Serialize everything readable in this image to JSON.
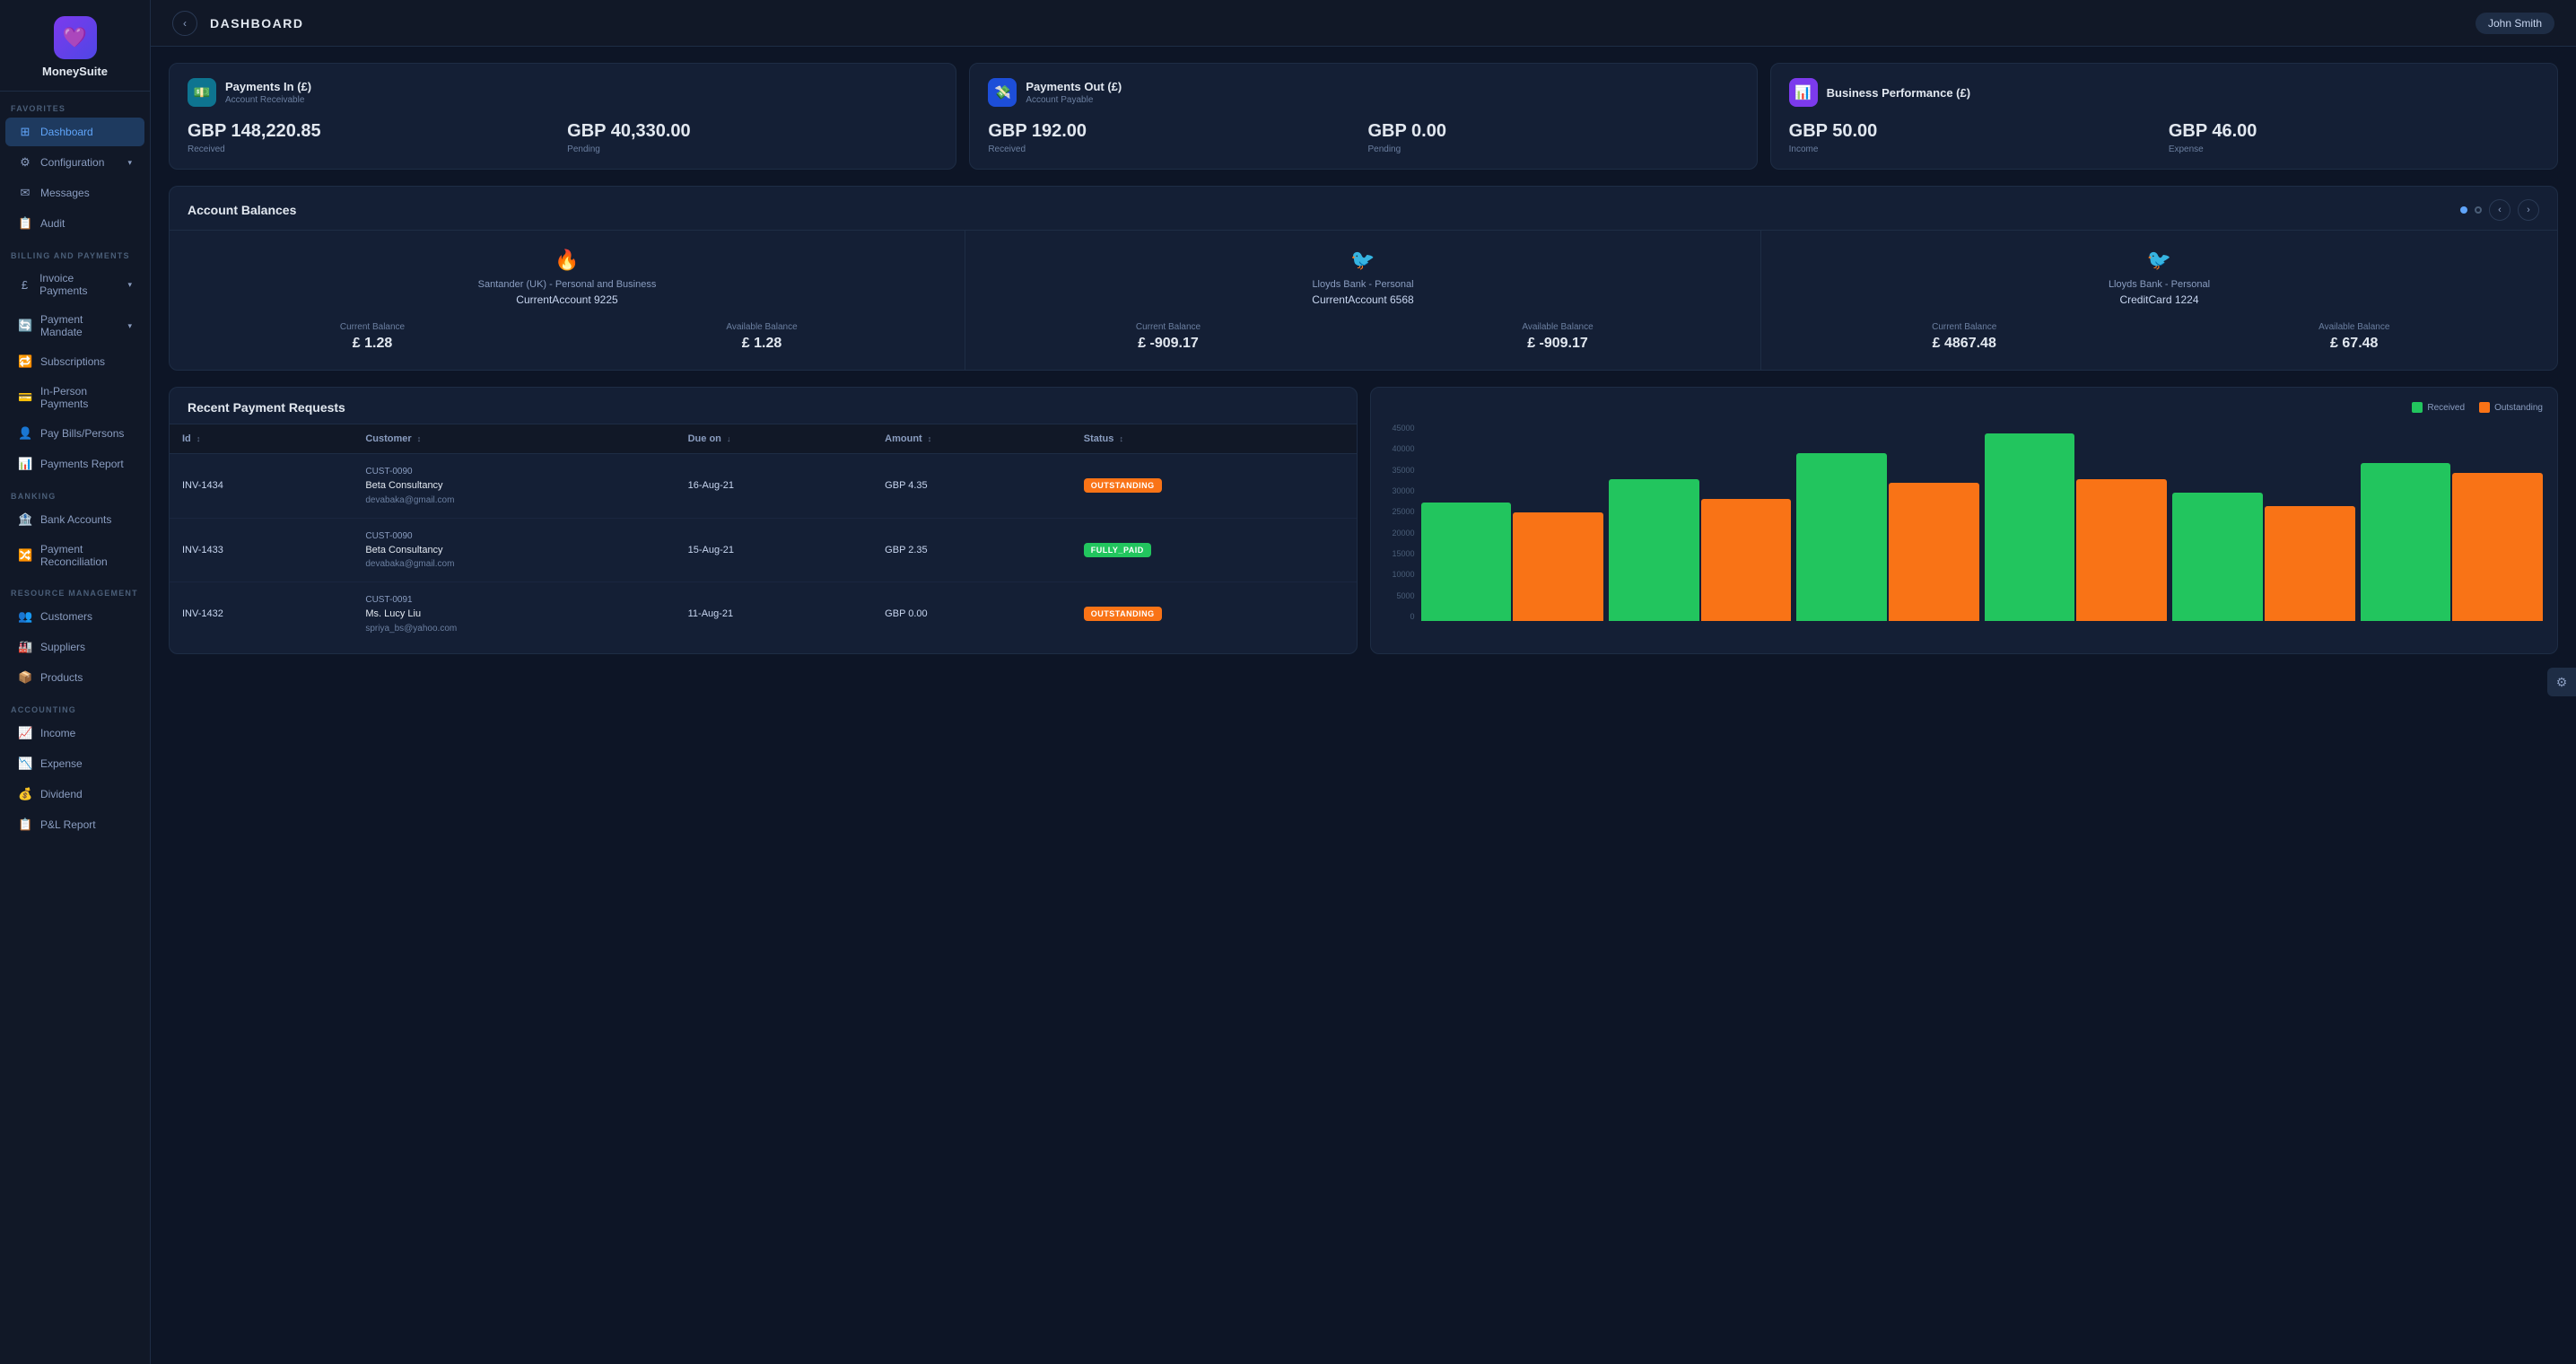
{
  "app": {
    "name": "MoneySuite",
    "logo_emoji": "💜"
  },
  "header": {
    "title": "DASHBOARD",
    "user": "John Smith",
    "back_label": "‹"
  },
  "sidebar": {
    "favorites_label": "FAVORITES",
    "favorites_items": [
      {
        "id": "dashboard",
        "label": "Dashboard",
        "icon": "⊞",
        "active": true
      },
      {
        "id": "configuration",
        "label": "Configuration",
        "icon": "⚙",
        "arrow": "▾"
      },
      {
        "id": "messages",
        "label": "Messages",
        "icon": "✉"
      },
      {
        "id": "audit",
        "label": "Audit",
        "icon": "📋"
      }
    ],
    "billing_label": "BILLING AND PAYMENTS",
    "billing_items": [
      {
        "id": "invoice-payments",
        "label": "Invoice Payments",
        "icon": "£",
        "arrow": "▾"
      },
      {
        "id": "payment-mandate",
        "label": "Payment Mandate",
        "icon": "🔄",
        "arrow": "▾"
      },
      {
        "id": "subscriptions",
        "label": "Subscriptions",
        "icon": "🔁"
      },
      {
        "id": "in-person",
        "label": "In-Person Payments",
        "icon": "💳"
      },
      {
        "id": "pay-bills",
        "label": "Pay Bills/Persons",
        "icon": "👤"
      },
      {
        "id": "payments-report",
        "label": "Payments Report",
        "icon": "📊"
      }
    ],
    "banking_label": "BANKING",
    "banking_items": [
      {
        "id": "bank-accounts",
        "label": "Bank Accounts",
        "icon": "🏦"
      },
      {
        "id": "payment-recon",
        "label": "Payment Reconciliation",
        "icon": "🔀"
      }
    ],
    "resource_label": "RESOURCE MANAGEMENT",
    "resource_items": [
      {
        "id": "customers",
        "label": "Customers",
        "icon": "👥"
      },
      {
        "id": "suppliers",
        "label": "Suppliers",
        "icon": "🏭"
      },
      {
        "id": "products",
        "label": "Products",
        "icon": "📦"
      }
    ],
    "accounting_label": "ACCOUNTING",
    "accounting_items": [
      {
        "id": "income",
        "label": "Income",
        "icon": "📈"
      },
      {
        "id": "expense",
        "label": "Expense",
        "icon": "📉"
      },
      {
        "id": "dividend",
        "label": "Dividend",
        "icon": "💰"
      },
      {
        "id": "pl-report",
        "label": "P&L Report",
        "icon": "📋"
      }
    ]
  },
  "metrics": {
    "payments_in": {
      "title": "Payments In (£)",
      "subtitle": "Account Receivable",
      "received_amount": "GBP 148,220.85",
      "received_label": "Received",
      "pending_amount": "GBP 40,330.00",
      "pending_label": "Pending"
    },
    "payments_out": {
      "title": "Payments Out (£)",
      "subtitle": "Account Payable",
      "received_amount": "GBP 192.00",
      "received_label": "Received",
      "pending_amount": "GBP 0.00",
      "pending_label": "Pending"
    },
    "business_performance": {
      "title": "Business Performance (£)",
      "income_amount": "GBP 50.00",
      "income_label": "Income",
      "expense_amount": "GBP 46.00",
      "expense_label": "Expense"
    }
  },
  "account_balances": {
    "section_title": "Account Balances",
    "cards": [
      {
        "bank": "Santander (UK) - Personal and Business",
        "account_label": "CurrentAccount 9225",
        "current_balance_label": "Current Balance",
        "current_balance": "£ 1.28",
        "available_balance_label": "Available Balance",
        "available_balance": "£ 1.28",
        "icon": "🔥"
      },
      {
        "bank": "Lloyds Bank - Personal",
        "account_label": "CurrentAccount 6568",
        "current_balance_label": "Current Balance",
        "current_balance": "£ -909.17",
        "available_balance_label": "Available Balance",
        "available_balance": "£ -909.17",
        "icon": "🦅"
      },
      {
        "bank": "Lloyds Bank - Personal",
        "account_label": "CreditCard 1224",
        "current_balance_label": "Current Balance",
        "current_balance": "£ 4867.48",
        "available_balance_label": "Available Balance",
        "available_balance": "£ 67.48",
        "icon": "🦅"
      }
    ]
  },
  "recent_payments": {
    "section_title": "Recent Payment Requests",
    "columns": {
      "id": "Id",
      "customer": "Customer",
      "due_on": "Due on",
      "amount": "Amount",
      "status": "Status"
    },
    "rows": [
      {
        "id": "INV-1434",
        "customer_id": "CUST-0090",
        "customer_name": "Beta Consultancy",
        "customer_email": "devabaka@gmail.com",
        "due_on": "16-Aug-21",
        "amount": "GBP 4.35",
        "status": "OUTSTANDING",
        "status_type": "outstanding"
      },
      {
        "id": "INV-1433",
        "customer_id": "CUST-0090",
        "customer_name": "Beta Consultancy",
        "customer_email": "devabaka@gmail.com",
        "due_on": "15-Aug-21",
        "amount": "GBP 2.35",
        "status": "FULLY_PAID",
        "status_type": "paid"
      },
      {
        "id": "INV-1432",
        "customer_id": "CUST-0091",
        "customer_name": "Ms. Lucy Liu",
        "customer_email": "spriya_bs@yahoo.com",
        "due_on": "11-Aug-21",
        "amount": "GBP 0.00",
        "status": "OUTSTANDING",
        "status_type": "outstanding"
      }
    ]
  },
  "chart": {
    "legend_received": "Received",
    "legend_outstanding": "Outstanding",
    "y_labels": [
      "45000",
      "40000",
      "35000",
      "30000",
      "25000",
      "20000",
      "15000",
      "10000",
      "5000",
      "0"
    ],
    "bar_groups": [
      {
        "green_pct": 60,
        "orange_pct": 55
      },
      {
        "green_pct": 72,
        "orange_pct": 62
      },
      {
        "green_pct": 85,
        "orange_pct": 70
      },
      {
        "green_pct": 95,
        "orange_pct": 72
      },
      {
        "green_pct": 65,
        "orange_pct": 58
      },
      {
        "green_pct": 80,
        "orange_pct": 75
      }
    ]
  }
}
